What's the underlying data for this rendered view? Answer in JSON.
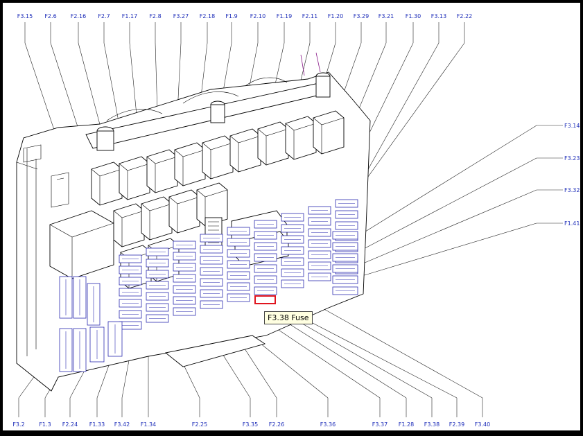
{
  "diagram": {
    "top_labels": [
      "F3.15",
      "F2.6",
      "F2.16",
      "F2.7",
      "F1.17",
      "F2.8",
      "F3.27",
      "F2.18",
      "F1.9",
      "F2.10",
      "F1.19",
      "F2.11",
      "F1.20",
      "F3.29",
      "F3.21",
      "F1.30",
      "F3.13",
      "F2.22"
    ],
    "right_labels": [
      "F3.14",
      "F3.23",
      "F3.32",
      "F1.41"
    ],
    "bottom_labels": [
      "F3.2",
      "F1.3",
      "F2.24",
      "F1.33",
      "F3.42",
      "F1.34",
      "F2.25",
      "F3.35",
      "F2.26",
      "F3.36",
      "F3.37",
      "F1.28",
      "F3.38",
      "F2.39",
      "F3.40"
    ],
    "highlighted_fuse": "F3.38",
    "tooltip": "F3.38 Fuse",
    "colors": {
      "label": "#1b2bb8",
      "fuse_outline": "#2a2ab0",
      "highlight": "#e0141e",
      "tooltip_bg": "#ffffe1"
    }
  }
}
